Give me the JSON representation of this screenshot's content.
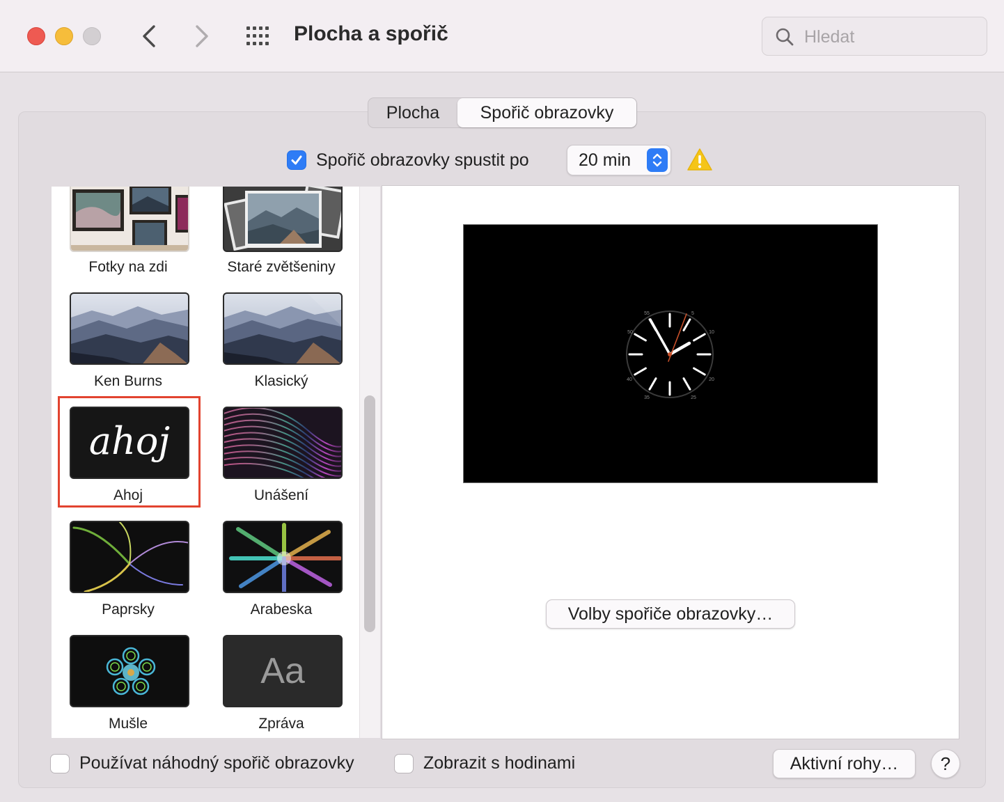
{
  "window": {
    "title": "Plocha a spořič",
    "search_placeholder": "Hledat"
  },
  "tabs": [
    {
      "label": "Plocha",
      "selected": false
    },
    {
      "label": "Spořič obrazovky",
      "selected": true
    }
  ],
  "start": {
    "checkbox_checked": true,
    "label": "Spořič obrazovky spustit po",
    "value": "20 min"
  },
  "savers": [
    {
      "label": "Fotky na zdi",
      "icon": "photo-wall-thumbnail"
    },
    {
      "label": "Staré zvětšeniny",
      "icon": "vintage-prints-thumbnail"
    },
    {
      "label": "Ken Burns",
      "icon": "mountains-thumbnail"
    },
    {
      "label": "Klasický",
      "icon": "mountains-thumbnail"
    },
    {
      "label": "Ahoj",
      "icon": "hello-thumbnail",
      "thumb_text": "ahoj",
      "selected": true
    },
    {
      "label": "Unášení",
      "icon": "drift-thumbnail"
    },
    {
      "label": "Paprsky",
      "icon": "flurry-thumbnail"
    },
    {
      "label": "Arabeska",
      "icon": "arabesque-thumbnail"
    },
    {
      "label": "Mušle",
      "icon": "shell-thumbnail"
    },
    {
      "label": "Zpráva",
      "icon": "message-thumbnail",
      "thumb_text": "Aa"
    }
  ],
  "clock": {
    "labels": [
      "55",
      "5",
      "50",
      "10",
      "40",
      "20",
      "35",
      "25"
    ]
  },
  "buttons": {
    "options": "Volby spořiče obrazovky…",
    "hot_corners": "Aktivní rohy…",
    "help": "?"
  },
  "bottom": {
    "random_label": "Používat náhodný spořič obrazovky",
    "random_checked": false,
    "clock_label": "Zobrazit s hodinami",
    "clock_checked": false
  },
  "colors": {
    "accent": "#2e7cf6",
    "selection_frame": "#e2432f",
    "warning": "#f5c518"
  }
}
